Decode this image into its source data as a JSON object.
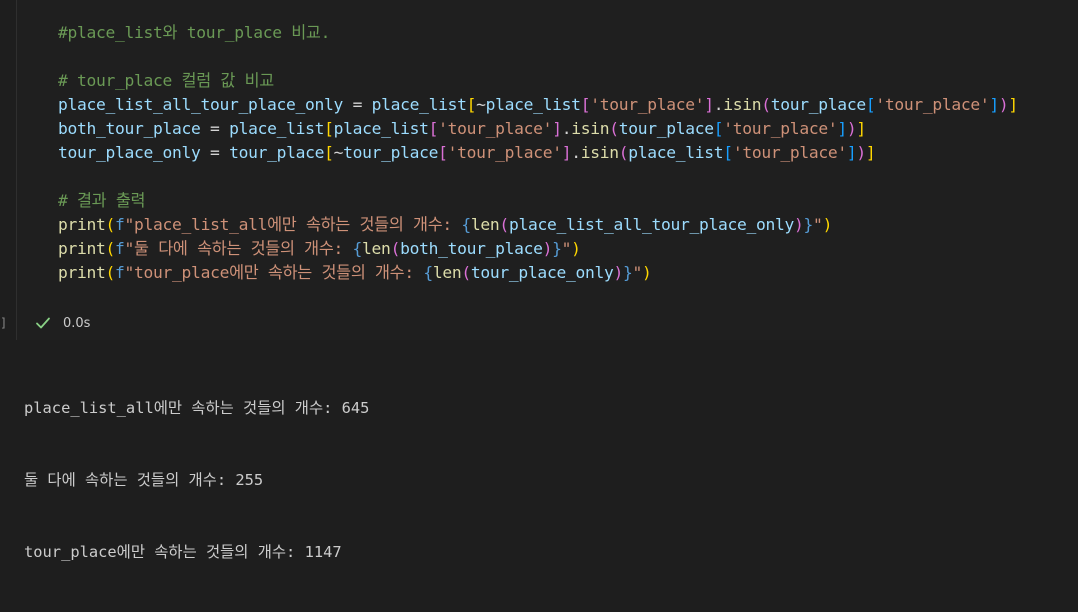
{
  "code_cell": {
    "lines": [
      [
        [
          "cm",
          "#place_list와 tour_place 비교."
        ]
      ],
      [],
      [
        [
          "cm",
          "# tour_place 컬럼 값 비교"
        ]
      ],
      [
        [
          "vr",
          "place_list_all_tour_place_only"
        ],
        [
          "op",
          " = "
        ],
        [
          "vr",
          "place_list"
        ],
        [
          "b1",
          "["
        ],
        [
          "op",
          "~"
        ],
        [
          "vr",
          "place_list"
        ],
        [
          "b2",
          "["
        ],
        [
          "st",
          "'tour_place'"
        ],
        [
          "b2",
          "]"
        ],
        [
          "op",
          "."
        ],
        [
          "fn",
          "isin"
        ],
        [
          "b2",
          "("
        ],
        [
          "vr",
          "tour_place"
        ],
        [
          "b3",
          "["
        ],
        [
          "st",
          "'tour_place'"
        ],
        [
          "b3",
          "]"
        ],
        [
          "b2",
          ")"
        ],
        [
          "b1",
          "]"
        ]
      ],
      [
        [
          "vr",
          "both_tour_place"
        ],
        [
          "op",
          " = "
        ],
        [
          "vr",
          "place_list"
        ],
        [
          "b1",
          "["
        ],
        [
          "vr",
          "place_list"
        ],
        [
          "b2",
          "["
        ],
        [
          "st",
          "'tour_place'"
        ],
        [
          "b2",
          "]"
        ],
        [
          "op",
          "."
        ],
        [
          "fn",
          "isin"
        ],
        [
          "b2",
          "("
        ],
        [
          "vr",
          "tour_place"
        ],
        [
          "b3",
          "["
        ],
        [
          "st",
          "'tour_place'"
        ],
        [
          "b3",
          "]"
        ],
        [
          "b2",
          ")"
        ],
        [
          "b1",
          "]"
        ]
      ],
      [
        [
          "vr",
          "tour_place_only"
        ],
        [
          "op",
          " = "
        ],
        [
          "vr",
          "tour_place"
        ],
        [
          "b1",
          "["
        ],
        [
          "op",
          "~"
        ],
        [
          "vr",
          "tour_place"
        ],
        [
          "b2",
          "["
        ],
        [
          "st",
          "'tour_place'"
        ],
        [
          "b2",
          "]"
        ],
        [
          "op",
          "."
        ],
        [
          "fn",
          "isin"
        ],
        [
          "b2",
          "("
        ],
        [
          "vr",
          "place_list"
        ],
        [
          "b3",
          "["
        ],
        [
          "st",
          "'tour_place'"
        ],
        [
          "b3",
          "]"
        ],
        [
          "b2",
          ")"
        ],
        [
          "b1",
          "]"
        ]
      ],
      [],
      [
        [
          "cm",
          "# 결과 출력"
        ]
      ],
      [
        [
          "fn",
          "print"
        ],
        [
          "b1",
          "("
        ],
        [
          "kw",
          "f"
        ],
        [
          "st",
          "\"place_list_all에만 속하는 것들의 개수: "
        ],
        [
          "kw",
          "{"
        ],
        [
          "fn",
          "len"
        ],
        [
          "b2",
          "("
        ],
        [
          "vr",
          "place_list_all_tour_place_only"
        ],
        [
          "b2",
          ")"
        ],
        [
          "kw",
          "}"
        ],
        [
          "st",
          "\""
        ],
        [
          "b1",
          ")"
        ]
      ],
      [
        [
          "fn",
          "print"
        ],
        [
          "b1",
          "("
        ],
        [
          "kw",
          "f"
        ],
        [
          "st",
          "\"둘 다에 속하는 것들의 개수: "
        ],
        [
          "kw",
          "{"
        ],
        [
          "fn",
          "len"
        ],
        [
          "b2",
          "("
        ],
        [
          "vr",
          "both_tour_place"
        ],
        [
          "b2",
          ")"
        ],
        [
          "kw",
          "}"
        ],
        [
          "st",
          "\""
        ],
        [
          "b1",
          ")"
        ]
      ],
      [
        [
          "fn",
          "print"
        ],
        [
          "b1",
          "("
        ],
        [
          "kw",
          "f"
        ],
        [
          "st",
          "\"tour_place에만 속하는 것들의 개수: "
        ],
        [
          "kw",
          "{"
        ],
        [
          "fn",
          "len"
        ],
        [
          "b2",
          "("
        ],
        [
          "vr",
          "tour_place_only"
        ],
        [
          "b2",
          ")"
        ],
        [
          "kw",
          "}"
        ],
        [
          "st",
          "\""
        ],
        [
          "b1",
          ")"
        ]
      ]
    ]
  },
  "status": {
    "icon": "check-icon",
    "time": "0.0s",
    "accent": "#89d185"
  },
  "output": {
    "lines": [
      "place_list_all에만 속하는 것들의 개수: 645",
      "둘 다에 속하는 것들의 개수: 255",
      "tour_place에만 속하는 것들의 개수: 1147"
    ]
  }
}
